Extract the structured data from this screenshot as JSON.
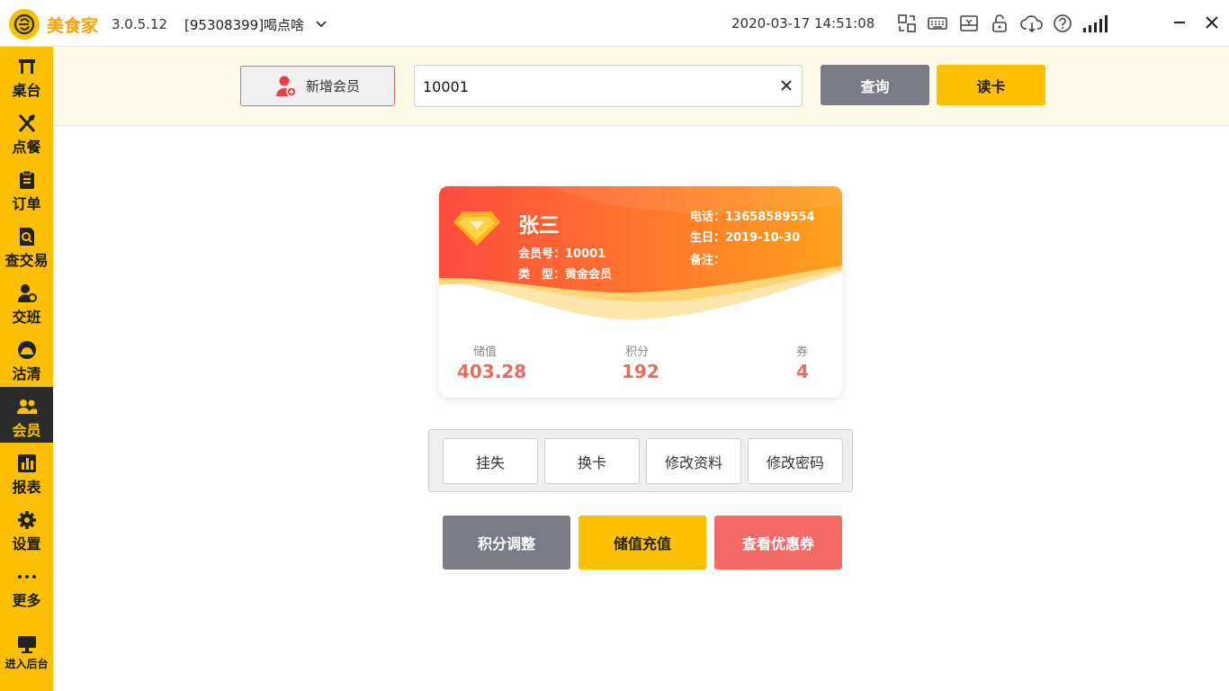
{
  "app": {
    "name": "美食家",
    "version": "3.0.5.12",
    "store": "[95308399]喝点啥",
    "datetime": "2020-03-17 14:51:08"
  },
  "toolbar_icons": [
    "switch-icon",
    "keyboard-icon",
    "cash-drawer-icon",
    "lock-icon",
    "cloud-icon",
    "help-icon",
    "signal-icon"
  ],
  "sidebar": {
    "items": [
      {
        "label": "桌台",
        "icon": "table-icon"
      },
      {
        "label": "点餐",
        "icon": "utensils-icon"
      },
      {
        "label": "订单",
        "icon": "clipboard-icon"
      },
      {
        "label": "查交易",
        "icon": "search-doc-icon"
      },
      {
        "label": "交班",
        "icon": "user-clock-icon"
      },
      {
        "label": "沽清",
        "icon": "cloche-icon"
      },
      {
        "label": "会员",
        "icon": "members-icon",
        "active": true
      },
      {
        "label": "报表",
        "icon": "bar-chart-icon"
      },
      {
        "label": "设置",
        "icon": "gear-icon"
      },
      {
        "label": "更多",
        "icon": "more-icon"
      },
      {
        "label": "进入后台",
        "icon": "monitor-icon"
      }
    ]
  },
  "search": {
    "add_member_label": "新增会员",
    "value": "10001",
    "query_label": "查询",
    "read_card_label": "读卡"
  },
  "card": {
    "name": "张三",
    "member_no": "会员号：10001",
    "type": "类　型：黄金会员",
    "phone": "电话：13658589554",
    "birthday": "生日：2019-10-30",
    "note": "备注：",
    "stats": [
      {
        "label": "储值",
        "value": "403.28"
      },
      {
        "label": "积分",
        "value": "192"
      },
      {
        "label": "券",
        "value": "4"
      }
    ]
  },
  "actions": [
    "挂失",
    "换卡",
    "修改资料",
    "修改密码"
  ],
  "buttons": {
    "points_adjust": "积分调整",
    "recharge": "储值充值",
    "view_coupons": "查看优惠券"
  },
  "colors": {
    "brand_yellow": "#fcc000",
    "sidebar_active": "#2b2b2b",
    "gray_button": "#7b7b85",
    "red_button": "#f46a66",
    "stat_red": "#e36e5e"
  }
}
